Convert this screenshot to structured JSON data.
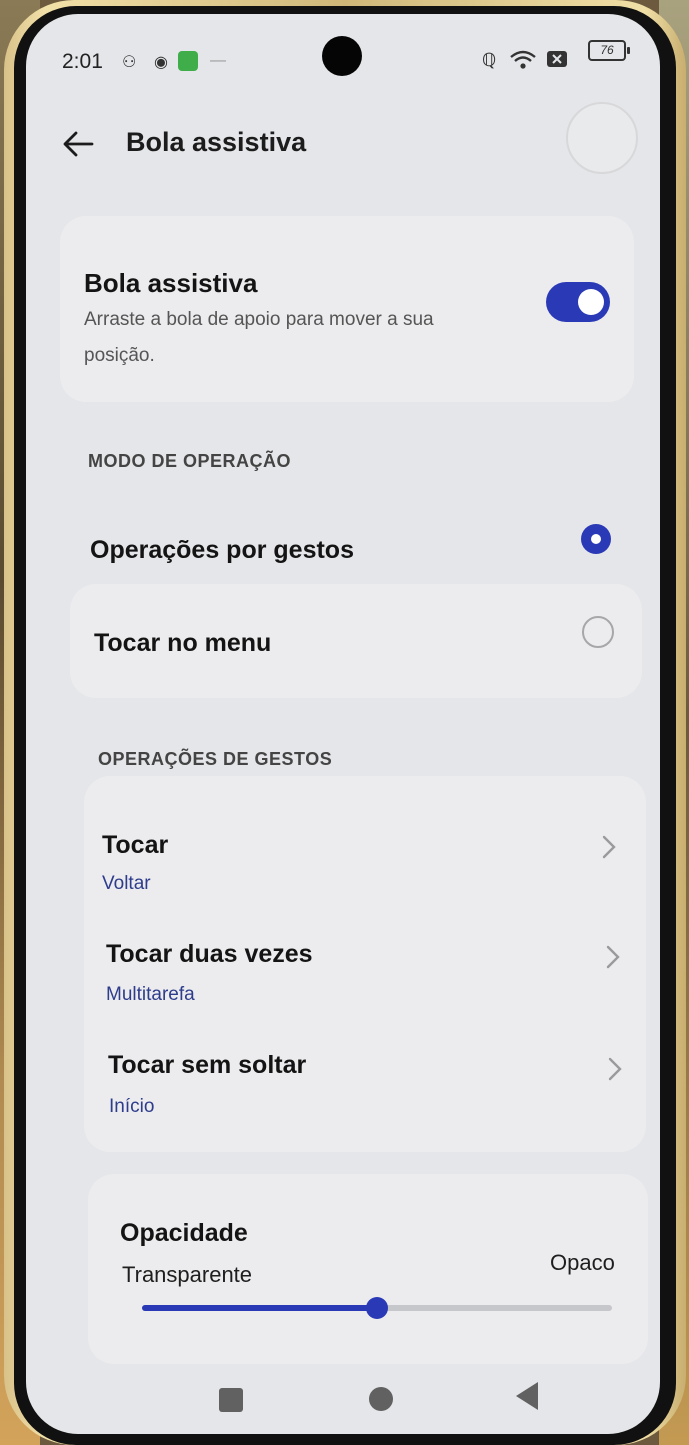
{
  "status_bar": {
    "time": "2:01",
    "battery": "76",
    "nfc_icon": "nfc-icon",
    "wifi_icon": "wifi-icon",
    "sim_icon": "no-sim-icon"
  },
  "header": {
    "title": "Bola assistiva",
    "back_icon": "arrow-left-icon"
  },
  "assistive_card": {
    "title": "Bola assistiva",
    "description": "Arraste a bola de apoio para mover a sua posição.",
    "enabled": true
  },
  "operation_mode": {
    "heading": "MODO DE OPERAÇÃO",
    "options": [
      {
        "label": "Operações por gestos",
        "selected": true
      },
      {
        "label": "Tocar no menu",
        "selected": false
      }
    ]
  },
  "gestures": {
    "heading": "OPERAÇÕES DE GESTOS",
    "items": [
      {
        "title": "Tocar",
        "value": "Voltar"
      },
      {
        "title": "Tocar duas vezes",
        "value": "Multitarefa"
      },
      {
        "title": "Tocar sem soltar",
        "value": "Início"
      }
    ]
  },
  "opacity": {
    "title": "Opacidade",
    "min_label": "Transparente",
    "max_label": "Opaco",
    "value_fraction": 0.5
  },
  "colors": {
    "accent": "#2a3ab6",
    "value_text": "#2e3c8c",
    "background": "#e5e6e9"
  },
  "nav_bar": {
    "icons": [
      "recents-square-icon",
      "home-circle-icon",
      "back-triangle-icon"
    ]
  }
}
